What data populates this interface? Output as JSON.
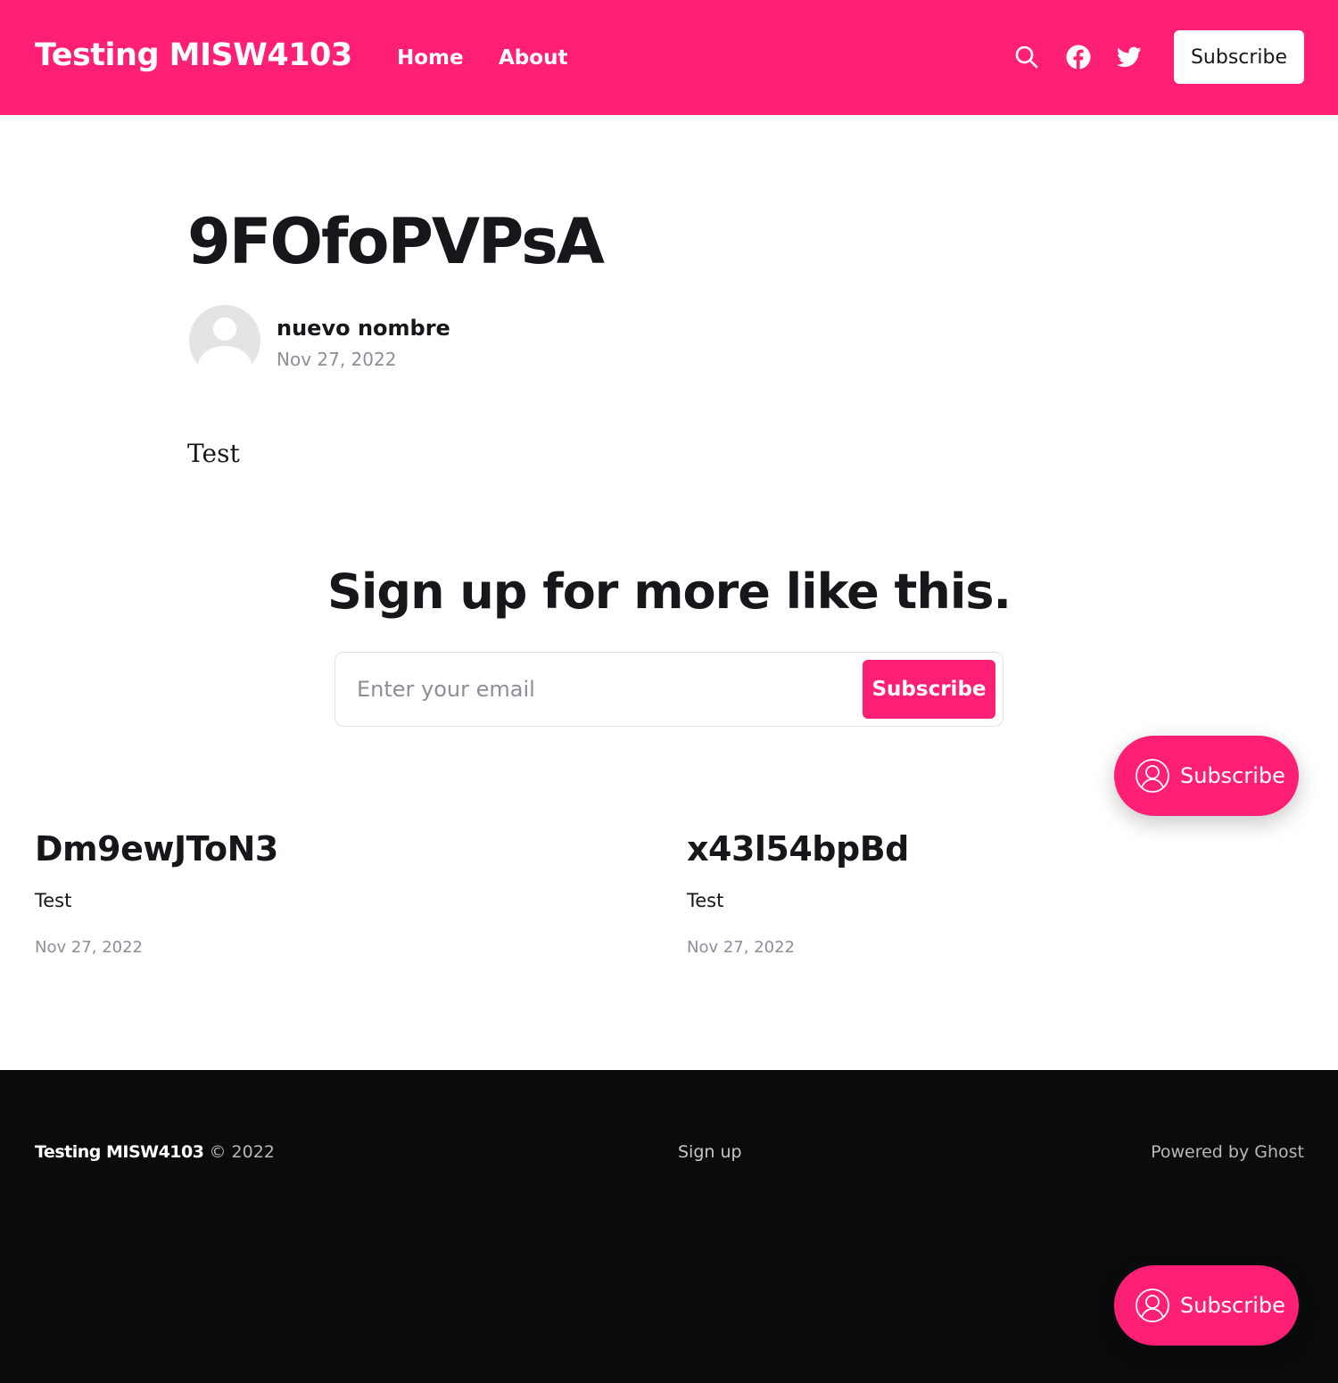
{
  "header": {
    "site_title": "Testing MISW4103",
    "nav": [
      {
        "label": "Home"
      },
      {
        "label": "About"
      }
    ],
    "icons": [
      "search-icon",
      "facebook-icon",
      "twitter-icon"
    ],
    "subscribe_label": "Subscribe"
  },
  "post": {
    "title": "9FOfoPVPsA",
    "author": "nuevo nombre",
    "date": "Nov 27, 2022",
    "body": "Test"
  },
  "cta": {
    "title": "Sign up for more like this.",
    "email_placeholder": "Enter your email",
    "button_label": "Subscribe"
  },
  "portal": {
    "label": "Subscribe"
  },
  "related": [
    {
      "title": "Dm9ewJToN3",
      "excerpt": "Test",
      "date": "Nov 27, 2022"
    },
    {
      "title": "x43l54bpBd",
      "excerpt": "Test",
      "date": "Nov 27, 2022"
    }
  ],
  "footer": {
    "brand": "Testing MISW4103",
    "copyright": "© 2022",
    "signup": "Sign up",
    "powered": "Powered by Ghost"
  },
  "colors": {
    "accent": "#ff1f74",
    "footer_bg": "#0a0b0d",
    "text": "#15171a",
    "muted": "#8a8f98"
  }
}
